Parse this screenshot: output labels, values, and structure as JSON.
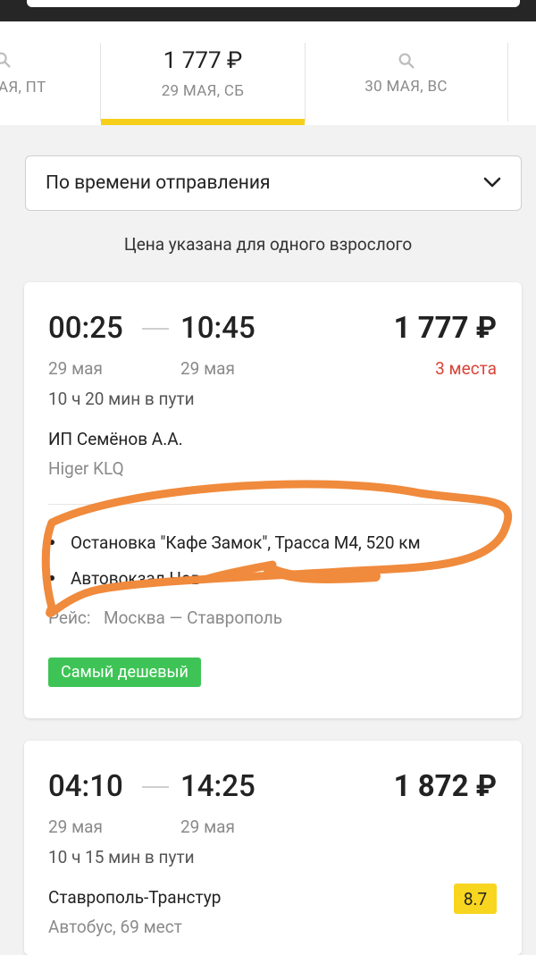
{
  "date_tabs": [
    {
      "date": "АЯ, ПТ",
      "price": ""
    },
    {
      "date": "29 МАЯ, СБ",
      "price": "1 777 ₽"
    },
    {
      "date": "30 МАЯ, ВС",
      "price": ""
    }
  ],
  "sort": {
    "label": "По времени отправления"
  },
  "price_note": "Цена указана для одного взрослого",
  "trips": [
    {
      "depart_time": "00:25",
      "arrive_time": "10:45",
      "price": "1 777 ₽",
      "depart_date": "29 мая",
      "arrive_date": "29 мая",
      "seats": "3 места",
      "duration": "10 ч 20 мин в пути",
      "carrier": "ИП Семёнов А.А.",
      "bus": "Higer KLQ",
      "stop_from": "Остановка \"Кафе Замок\", Трасса М4, 520 км",
      "stop_to": "Автовокзал Нов",
      "route_label": "Рейс:",
      "route": "Москва — Ставрополь",
      "badge": "Самый дешевый"
    },
    {
      "depart_time": "04:10",
      "arrive_time": "14:25",
      "price": "1 872 ₽",
      "depart_date": "29 мая",
      "arrive_date": "29 мая",
      "duration": "10 ч 15 мин в пути",
      "carrier": "Ставрополь-Транстур",
      "rating": "8.7",
      "bus": "Автобус, 69 мест"
    }
  ],
  "colors": {
    "accent": "#f6cf1b",
    "cheap": "#3ec456",
    "seats": "#d9443a",
    "annotation": "#f08a3c"
  },
  "icons": [
    "search-icon",
    "chevron-down-icon"
  ]
}
